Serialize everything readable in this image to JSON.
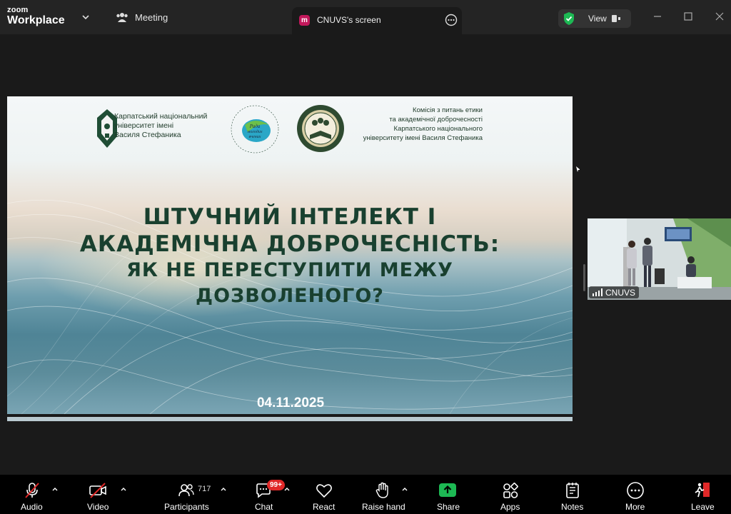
{
  "app": {
    "brand_top": "zoom",
    "brand_bottom": "Workplace"
  },
  "topbar": {
    "meeting_label": "Meeting",
    "share_tab": {
      "initial": "m",
      "title": "CNUVS's screen"
    },
    "view_label": "View"
  },
  "slide": {
    "university_name": [
      "Карпатський національний",
      "університет імені",
      "Василя Стефаника"
    ],
    "emblem_text": {
      "ring": "Міністерство освіти і науки України",
      "center_top": "Рада",
      "center_mid": "молодих",
      "center_bottom": "вчених"
    },
    "commission": [
      "Комісія з питань етики",
      "та академічної доброчесності",
      "Карпатського національного",
      "університету імені Василя Стефаника"
    ],
    "title_line1": "ШТУЧНИЙ ІНТЕЛЕКТ І",
    "title_line2": "АКАДЕМІЧНА ДОБРОЧЕСНІСТЬ:",
    "title_line3": "ЯК НЕ ПЕРЕСТУПИТИ МЕЖУ",
    "title_line4": "ДОЗВОЛЕНОГО?",
    "date": "04.11.2025"
  },
  "participant_tile": {
    "name": "CNUVS"
  },
  "toolbar": {
    "audio": "Audio",
    "video": "Video",
    "participants": "Participants",
    "participants_count": "717",
    "chat": "Chat",
    "chat_badge": "99+",
    "react": "React",
    "raise_hand": "Raise hand",
    "share": "Share",
    "apps": "Apps",
    "notes": "Notes",
    "more": "More",
    "leave": "Leave"
  },
  "colors": {
    "share_green": "#1db954",
    "leave_red": "#e02828",
    "mute_red": "#e02828",
    "slide_title": "#19402f"
  }
}
